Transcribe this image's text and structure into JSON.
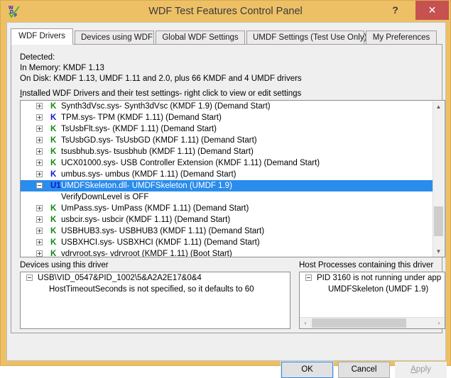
{
  "window": {
    "title": "WDF Test Features Control Panel",
    "icon": "wdf-logo-icon",
    "help_label": "?",
    "close_label": "✕"
  },
  "tabs": [
    {
      "label": "WDF Drivers",
      "active": true
    },
    {
      "label": "Devices using WDF",
      "active": false
    },
    {
      "label": "Global WDF Settings",
      "active": false
    },
    {
      "label": "UMDF Settings (Test Use Only)",
      "active": false
    },
    {
      "label": "My Preferences",
      "active": false
    }
  ],
  "detected": {
    "line1": "Detected:",
    "line2": "In Memory: KMDF 1.13",
    "line3": "On Disk: KMDF 1.13, UMDF 1.11 and 2.0, plus 66 KMDF and 4 UMDF drivers"
  },
  "installed_label": {
    "accesskey": "I",
    "rest": "nstalled WDF Drivers and their test settings- right click to view or edit settings"
  },
  "driver_tree": {
    "rows": [
      {
        "expander": "plus",
        "mark": "K",
        "mark_color": "green",
        "label": "Synth3dVsc.sys- Synth3dVsc (KMDF 1.9) (Demand Start)",
        "selected": false,
        "child": false
      },
      {
        "expander": "plus",
        "mark": "K",
        "mark_color": "blue",
        "label": "TPM.sys- TPM (KMDF 1.11) (Demand Start)",
        "selected": false,
        "child": false
      },
      {
        "expander": "plus",
        "mark": "K",
        "mark_color": "green",
        "label": "TsUsbFlt.sys-  (KMDF 1.11) (Demand Start)",
        "selected": false,
        "child": false
      },
      {
        "expander": "plus",
        "mark": "K",
        "mark_color": "green",
        "label": "TsUsbGD.sys- TsUsbGD (KMDF 1.11) (Demand Start)",
        "selected": false,
        "child": false
      },
      {
        "expander": "plus",
        "mark": "K",
        "mark_color": "green",
        "label": "tsusbhub.sys- tsusbhub (KMDF 1.11) (Demand Start)",
        "selected": false,
        "child": false
      },
      {
        "expander": "plus",
        "mark": "K",
        "mark_color": "green",
        "label": "UCX01000.sys- USB Controller Extension (KMDF 1.11) (Demand Start)",
        "selected": false,
        "child": false
      },
      {
        "expander": "plus",
        "mark": "K",
        "mark_color": "blue",
        "label": "umbus.sys- umbus (KMDF 1.11) (Demand Start)",
        "selected": false,
        "child": false
      },
      {
        "expander": "minus",
        "mark": "U1",
        "mark_color": "blue",
        "label": "UMDFSkeleton.dll- UMDFSkeleton (UMDF 1.9)",
        "selected": true,
        "child": false
      },
      {
        "expander": "none",
        "mark": "",
        "mark_color": "",
        "label": "VerifyDownLevel is OFF",
        "selected": false,
        "child": true
      },
      {
        "expander": "plus",
        "mark": "K",
        "mark_color": "green",
        "label": "UmPass.sys- UmPass (KMDF 1.11) (Demand Start)",
        "selected": false,
        "child": false
      },
      {
        "expander": "plus",
        "mark": "K",
        "mark_color": "green",
        "label": "usbcir.sys- usbcir (KMDF 1.11) (Demand Start)",
        "selected": false,
        "child": false
      },
      {
        "expander": "plus",
        "mark": "K",
        "mark_color": "green",
        "label": "USBHUB3.sys- USBHUB3 (KMDF 1.11) (Demand Start)",
        "selected": false,
        "child": false
      },
      {
        "expander": "plus",
        "mark": "K",
        "mark_color": "green",
        "label": "USBXHCI.sys- USBXHCI (KMDF 1.11) (Demand Start)",
        "selected": false,
        "child": false
      },
      {
        "expander": "plus",
        "mark": "K",
        "mark_color": "green",
        "label": "vdrvroot.sys- vdrvroot (KMDF 1.11) (Boot Start)",
        "selected": false,
        "child": false
      }
    ],
    "scroll_up": "▲",
    "scroll_down": "▼"
  },
  "devices_panel": {
    "label": "Devices using this driver",
    "rows": [
      {
        "expander": "minus",
        "label": "USB\\VID_0547&PID_1002\\5&A2A2E17&0&4",
        "sub": false
      },
      {
        "expander": "none",
        "label": "HostTimeoutSeconds is not specified, so it defaults to 60",
        "sub": true
      }
    ]
  },
  "hosts_panel": {
    "label": "Host Processes containing this driver",
    "rows": [
      {
        "expander": "minus",
        "label": "PID 3160 is not running under app",
        "sub": false
      },
      {
        "expander": "none",
        "label": "UMDFSkeleton (UMDF 1.9)",
        "sub": true
      }
    ],
    "scroll_left": "‹",
    "scroll_right": "›"
  },
  "buttons": {
    "ok": "OK",
    "cancel": "Cancel",
    "apply_accesskey": "A",
    "apply_rest": "pply"
  },
  "colors": {
    "window_frame": "#edc066",
    "title_text": "#3a3a3a",
    "close_button": "#c75050",
    "selection": "#2a8cec",
    "kmdf_green": "#128812",
    "kmdf_blue": "#1414d6"
  }
}
